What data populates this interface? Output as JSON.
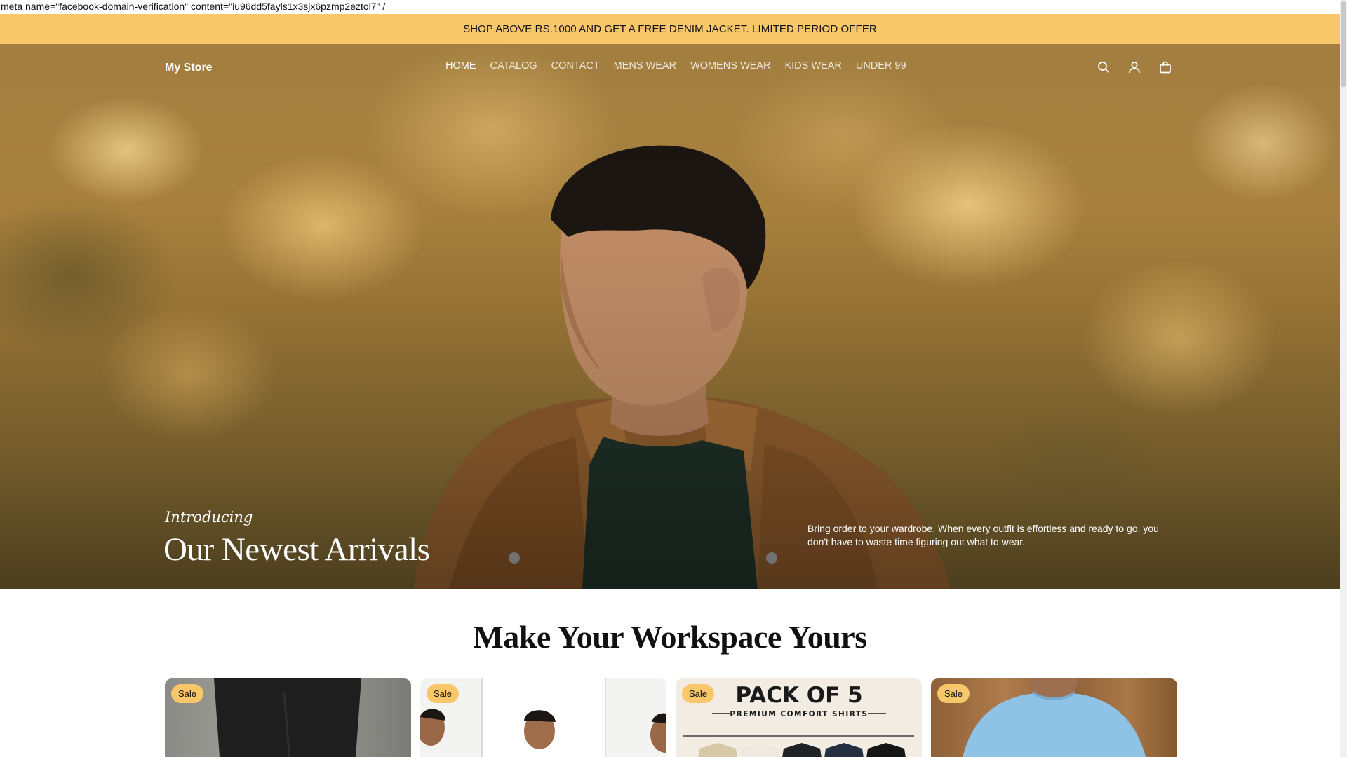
{
  "meta_leak_text": "meta name=\"facebook-domain-verification\" content=\"iu96dd5fayls1x3sjx6pzmp2eztol7\" /",
  "announcement": {
    "text": "SHOP ABOVE RS.1000 AND GET A FREE DENIM JACKET. LIMITED PERIOD OFFER"
  },
  "header": {
    "logo": "My Store",
    "nav": [
      {
        "label": "HOME",
        "active": true
      },
      {
        "label": "CATALOG"
      },
      {
        "label": "CONTACT"
      },
      {
        "label": "MENS WEAR"
      },
      {
        "label": "WOMENS WEAR"
      },
      {
        "label": "KIDS WEAR"
      },
      {
        "label": "UNDER 99"
      }
    ],
    "icons": [
      "search-icon",
      "account-icon",
      "cart-icon"
    ]
  },
  "hero": {
    "kicker": "Introducing",
    "title": "Our Newest Arrivals",
    "text": "Bring order to your wardrobe. When every outfit is effortless and ready to go, you don't have to waste time figuring out what to wear."
  },
  "collection": {
    "title": "Make Your Workspace Yours",
    "products": [
      {
        "badge": "Sale"
      },
      {
        "badge": "Sale"
      },
      {
        "badge": "Sale",
        "image_text": "PACK OF 5",
        "image_subtext": "PREMIUM COMFORT SHIRTS"
      },
      {
        "badge": "Sale"
      }
    ]
  },
  "colors": {
    "announcement_bg": "#f7c76a",
    "badge_bg": "#f7c76a",
    "hero_text": "#ffffff"
  }
}
